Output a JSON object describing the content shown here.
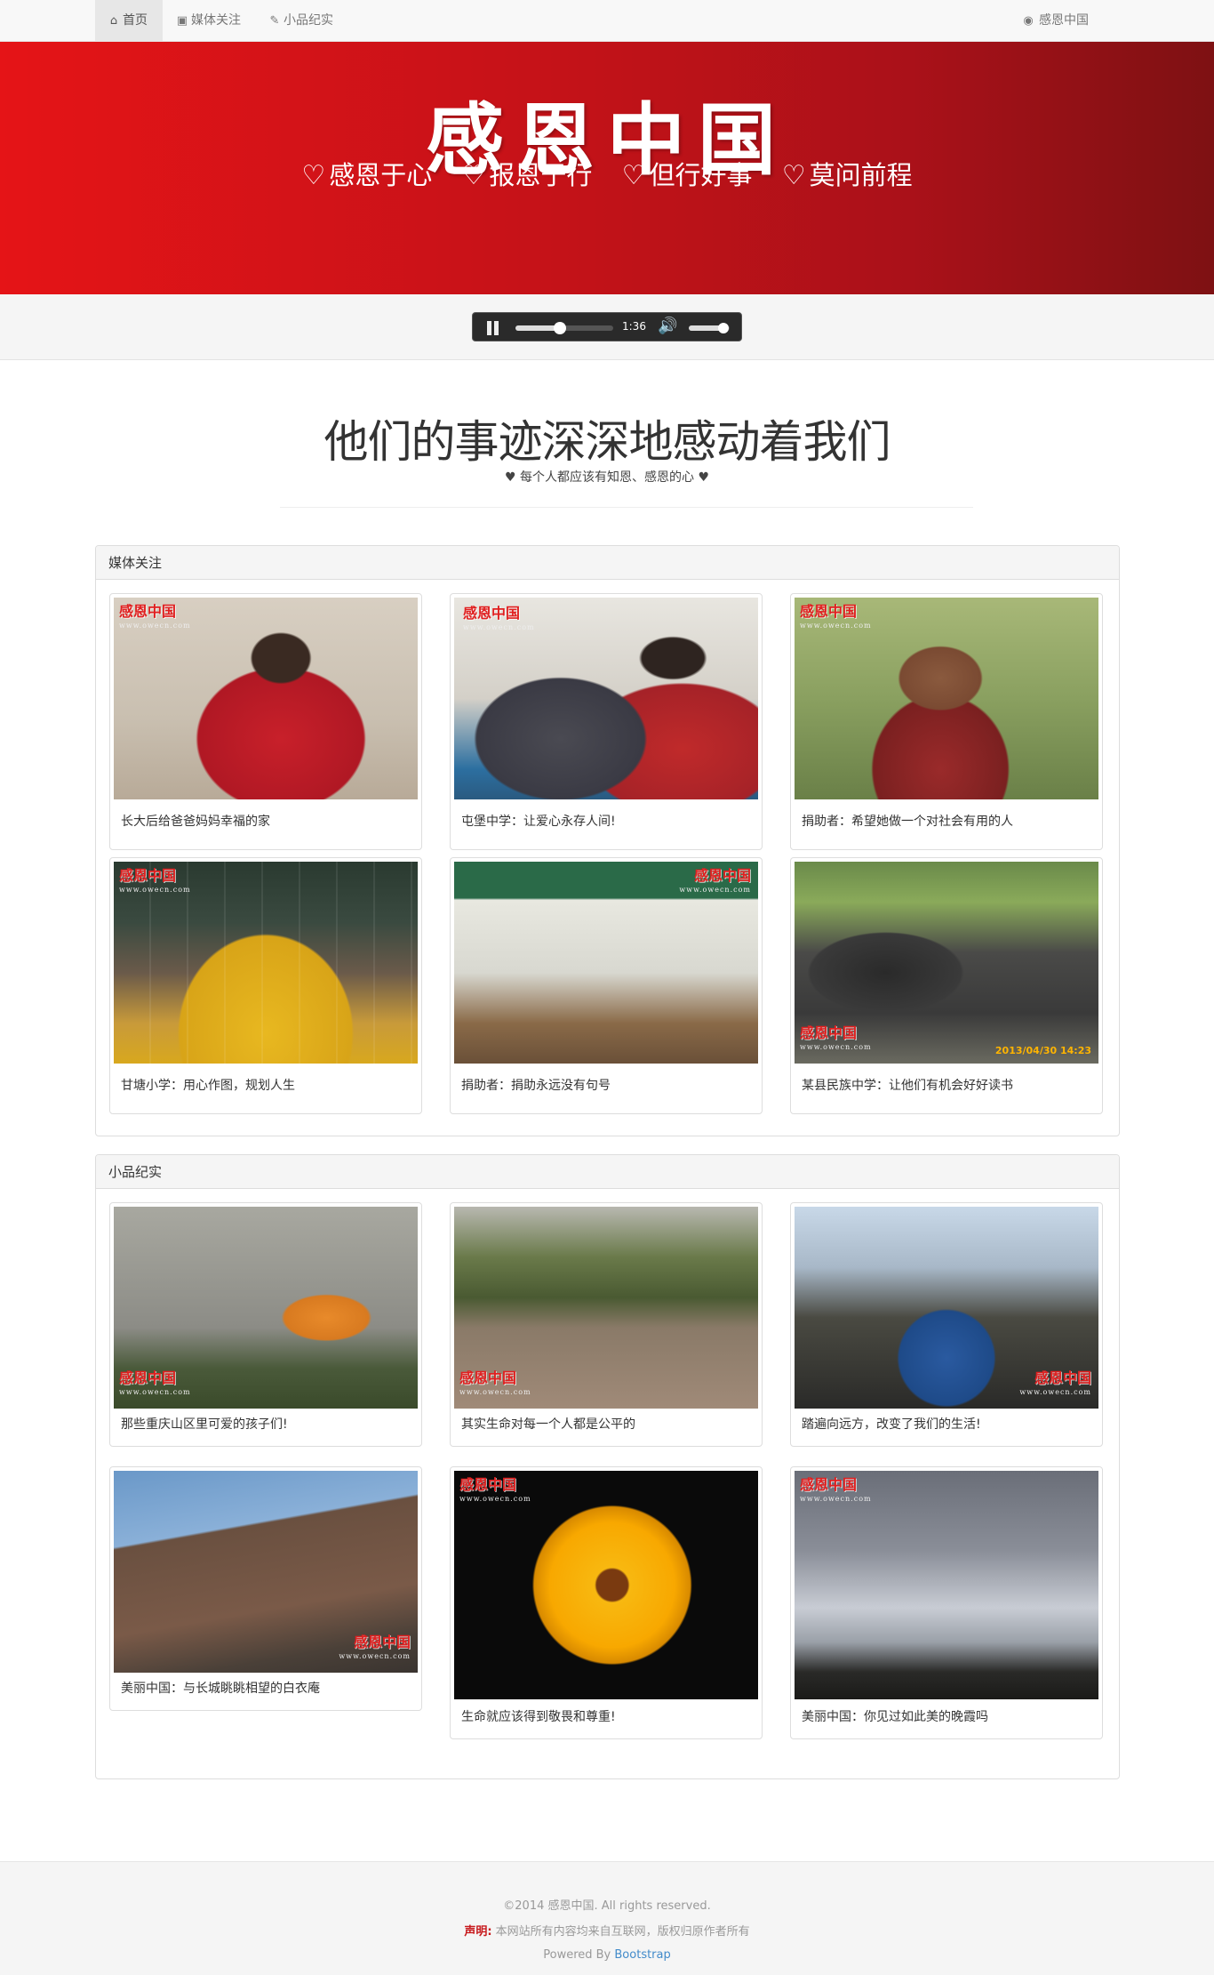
{
  "nav": {
    "items": [
      {
        "icon": "home-icon",
        "label": "首页"
      },
      {
        "icon": "camera-icon",
        "label": "媒体关注"
      },
      {
        "icon": "edit-icon",
        "label": "小品纪实"
      }
    ],
    "right": {
      "icon": "eye-icon",
      "label": "感恩中国"
    }
  },
  "banner": {
    "title": "感恩中国",
    "mottos": [
      "感恩于心",
      "报恩于行",
      "但行好事",
      "莫问前程"
    ]
  },
  "player": {
    "time": "1:36",
    "progress": 0.45,
    "volume": 0.85
  },
  "heading": {
    "title": "他们的事迹深深地感动着我们",
    "subtitle": "每个人都应该有知恩、感恩的心"
  },
  "media_panel": {
    "title": "媒体关注",
    "cards": [
      {
        "caption": "长大后给爸爸妈妈幸福的家",
        "watermark": "感恩中国",
        "site": "www.owecn.com"
      },
      {
        "caption": "屯堡中学：让爱心永存人间!",
        "watermark": "感恩中国",
        "site": "www.owecn.com"
      },
      {
        "caption": "捐助者：希望她做一个对社会有用的人",
        "watermark": "感恩中国",
        "site": "www.owecn.com"
      },
      {
        "caption": "甘塘小学：用心作图，规划人生",
        "watermark": "感恩中国",
        "site": "www.owecn.com"
      },
      {
        "caption": "捐助者：捐助永远没有句号",
        "watermark": "感恩中国",
        "site": "www.owecn.com"
      },
      {
        "caption": "某县民族中学：让他们有机会好好读书",
        "watermark": "感恩中国",
        "site": "www.owecn.com",
        "stamp": "2013/04/30 14:23"
      }
    ]
  },
  "story_panel": {
    "title": "小品纪实",
    "cards": [
      {
        "caption": "那些重庆山区里可爱的孩子们!",
        "watermark": "感恩中国",
        "site": "www.owecn.com"
      },
      {
        "caption": "其实生命对每一个人都是公平的",
        "watermark": "感恩中国",
        "site": "www.owecn.com"
      },
      {
        "caption": "踏遍向远方，改变了我们的生活!",
        "watermark": "感恩中国",
        "site": "www.owecn.com"
      },
      {
        "caption": "美丽中国：与长城眺眺相望的白衣庵",
        "watermark": "感恩中国",
        "site": "www.owecn.com"
      },
      {
        "caption": "生命就应该得到敬畏和尊重!",
        "watermark": "感恩中国",
        "site": "www.owecn.com"
      },
      {
        "caption": "美丽中国：你见过如此美的晚霞吗",
        "watermark": "感恩中国",
        "site": "www.owecn.com"
      }
    ]
  },
  "footer": {
    "copyright": "©2014 感恩中国. All rights reserved.",
    "notice_label": "声明:",
    "notice_text": "本网站所有内容均来自互联网，版权归原作者所有",
    "powered_prefix": "Powered By ",
    "powered_link": "Bootstrap"
  },
  "colors": {
    "banner_start": "#e51417",
    "banner_end": "#7e1113",
    "link": "#428bca",
    "watermark": "#e02020"
  }
}
